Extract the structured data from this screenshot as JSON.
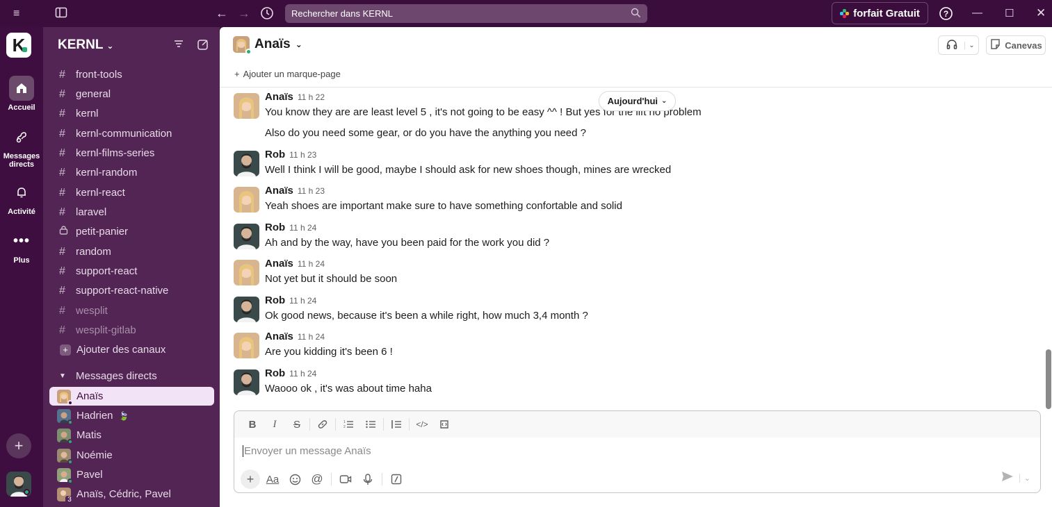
{
  "topbar": {
    "search_placeholder": "Rechercher dans KERNL",
    "plan_label": "forfait Gratuit"
  },
  "rail": {
    "workspace_initial": "K",
    "items": [
      {
        "label": "Accueil"
      },
      {
        "label": "Messages directs"
      },
      {
        "label": "Activité"
      },
      {
        "label": "Plus"
      }
    ]
  },
  "sidebar": {
    "workspace_name": "KERNL",
    "channels": [
      {
        "name": "front-tools",
        "icon": "#"
      },
      {
        "name": "general",
        "icon": "#"
      },
      {
        "name": "kernl",
        "icon": "#"
      },
      {
        "name": "kernl-communication",
        "icon": "#"
      },
      {
        "name": "kernl-films-series",
        "icon": "#"
      },
      {
        "name": "kernl-random",
        "icon": "#"
      },
      {
        "name": "kernl-react",
        "icon": "#"
      },
      {
        "name": "laravel",
        "icon": "#"
      },
      {
        "name": "petit-panier",
        "icon": "lock"
      },
      {
        "name": "random",
        "icon": "#"
      },
      {
        "name": "support-react",
        "icon": "#"
      },
      {
        "name": "support-react-native",
        "icon": "#"
      },
      {
        "name": "wesplit",
        "icon": "#"
      },
      {
        "name": "wesplit-gitlab",
        "icon": "#"
      }
    ],
    "add_channels": "Ajouter des canaux",
    "dm_section": "Messages directs",
    "dms": [
      {
        "name": "Anaïs"
      },
      {
        "name": "Hadrien"
      },
      {
        "name": "Matis"
      },
      {
        "name": "Noémie"
      },
      {
        "name": "Pavel"
      },
      {
        "name": "Anaïs, Cédric, Pavel",
        "count": "3"
      }
    ]
  },
  "main": {
    "title": "Anaïs",
    "bookmark": "Ajouter un marque-page",
    "canvas_label": "Canevas",
    "date_divider": "Aujourd'hui",
    "messages": [
      {
        "author": "Anaïs",
        "time": "11 h 22",
        "text": "You know they are are least level 5 , it's not going to be easy ^^ ! But yes for the lift no problem"
      },
      {
        "author": "",
        "time": "",
        "text": "Also do you need some gear, or do you have the anything you need ?"
      },
      {
        "author": "Rob",
        "time": "11 h 23",
        "text": "Well I think I will be good, maybe I should ask for new shoes though, mines are wrecked"
      },
      {
        "author": "Anaïs",
        "time": "11 h 23",
        "text": "Yeah shoes are important make sure to have something confortable and solid"
      },
      {
        "author": "Rob",
        "time": "11 h 24",
        "text": "Ah and by the way, have you been paid for the work you did ?"
      },
      {
        "author": "Anaïs",
        "time": "11 h 24",
        "text": "Not yet but it should be soon"
      },
      {
        "author": "Rob",
        "time": "11 h 24",
        "text": "Ok good news, because it's been a while right, how much 3,4 month ?"
      },
      {
        "author": "Anaïs",
        "time": "11 h 24",
        "text": "Are you kidding it's been 6 !"
      },
      {
        "author": "Rob",
        "time": "11 h 24",
        "text": "Waooo ok , it's was about time haha"
      }
    ],
    "composer_placeholder": "Envoyer un message Anaïs"
  },
  "colors": {
    "aubergine": "#3f0e40",
    "sidebar": "#532554",
    "online": "#2bac76"
  }
}
